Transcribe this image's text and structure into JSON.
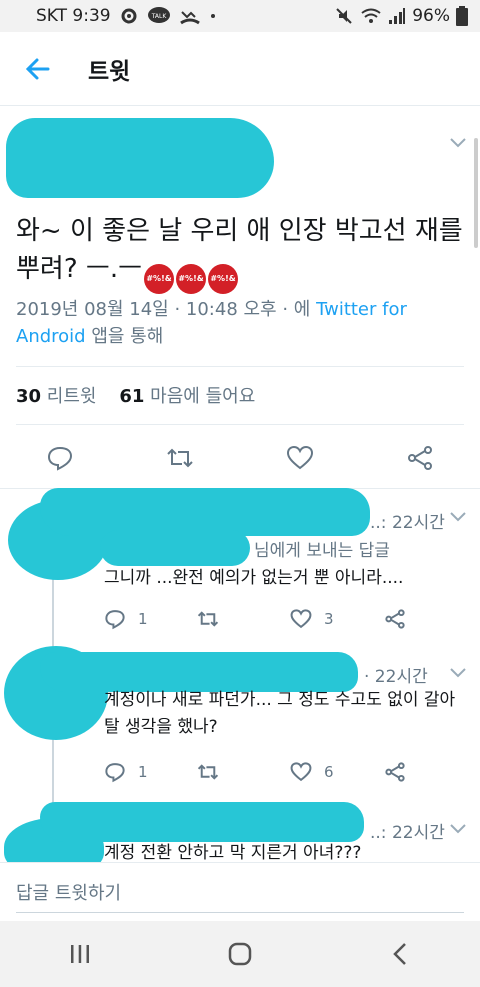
{
  "statusbar": {
    "carrier_time": "SKT 9:39",
    "talk_badge": "TALK",
    "battery": "96%"
  },
  "appbar": {
    "title": "트윗"
  },
  "tweet": {
    "text": "와~ 이 좋은 날 우리 애 인장 박고선 재를 뿌려? ㅡ.ㅡ",
    "emoji_label": "#%!&",
    "meta_date": "2019년 08월 14일 · 10:48 오후 · 에 ",
    "meta_source": "Twitter for Android",
    "meta_suffix": " 앱을 통해",
    "retweet_count": "30",
    "retweet_label": "리트윗",
    "like_count": "61",
    "like_label": "마음에 들어요"
  },
  "replies": [
    {
      "time": "..: 22시간",
      "reply_to": "님에게 보내는 답글",
      "text": "그니까 ...완전 예의가 없는거 뿐 아니라....",
      "reply_count": "1",
      "like_count": "3"
    },
    {
      "time": "· 22시간",
      "text": "계정이나 새로 파던가... 그 정도 수고도 없이 갈아탈 생각을 했나?",
      "reply_count": "1",
      "like_count": "6"
    },
    {
      "time": "..: 22시간",
      "text": "계정 전환 안하고 막 지른거 아녀???"
    }
  ],
  "compose": {
    "placeholder": "답글 트윗하기"
  },
  "colors": {
    "accent": "#1da1f2",
    "redaction": "#27c6d6",
    "muted": "#657786"
  }
}
